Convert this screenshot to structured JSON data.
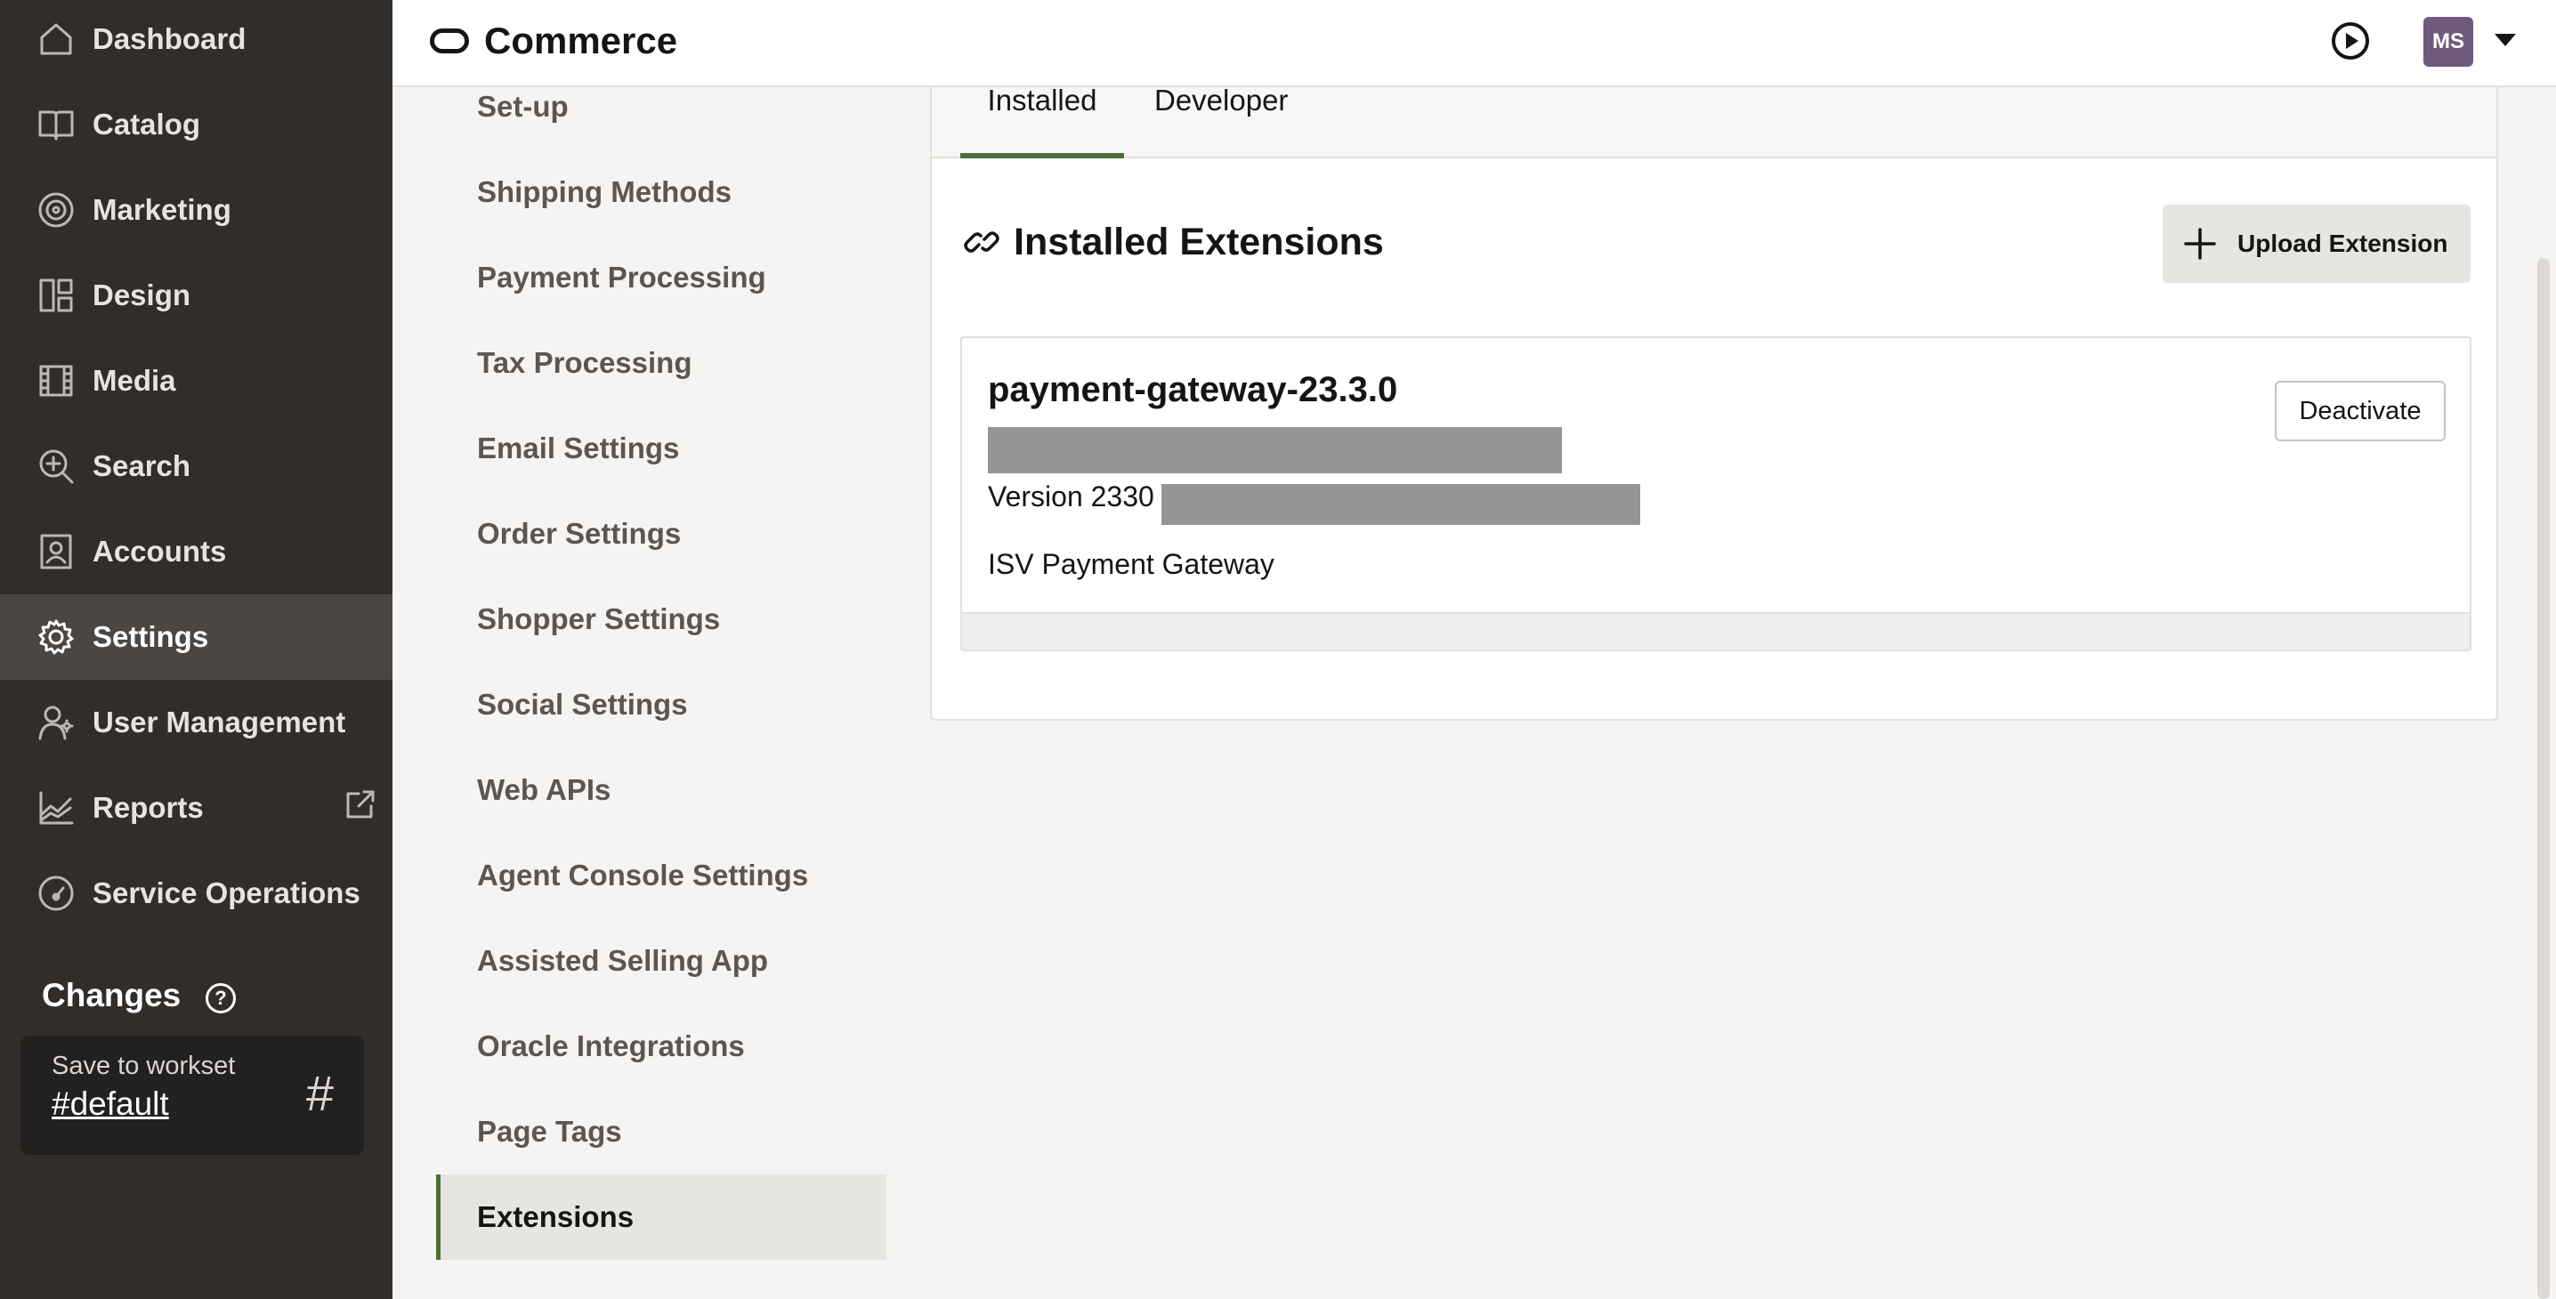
{
  "nav": {
    "items": [
      {
        "label": "Dashboard",
        "icon": "home-icon"
      },
      {
        "label": "Catalog",
        "icon": "book-icon"
      },
      {
        "label": "Marketing",
        "icon": "target-icon"
      },
      {
        "label": "Design",
        "icon": "layout-icon"
      },
      {
        "label": "Media",
        "icon": "film-icon"
      },
      {
        "label": "Search",
        "icon": "search-plus-icon"
      },
      {
        "label": "Accounts",
        "icon": "contact-card-icon"
      },
      {
        "label": "Settings",
        "icon": "gear-icon",
        "active": true
      },
      {
        "label": "User Management",
        "icon": "users-icon"
      },
      {
        "label": "Reports",
        "icon": "chart-icon",
        "external": true
      },
      {
        "label": "Service Operations",
        "icon": "gauge-icon"
      }
    ],
    "changes": {
      "title": "Changes",
      "help": "?",
      "workset_label": "Save to workset",
      "workset_value": "#default",
      "hash": "#"
    }
  },
  "header": {
    "title": "Commerce",
    "avatar_initials": "MS"
  },
  "settings_menu": {
    "items": [
      "Set-up",
      "Shipping Methods",
      "Payment Processing",
      "Tax Processing",
      "Email Settings",
      "Order Settings",
      "Shopper Settings",
      "Social Settings",
      "Web APIs",
      "Agent Console Settings",
      "Assisted Selling App",
      "Oracle Integrations",
      "Page Tags",
      "Extensions"
    ],
    "active": "Extensions"
  },
  "main": {
    "tabs": [
      {
        "label": "Installed",
        "active": true
      },
      {
        "label": "Developer",
        "active": false
      }
    ],
    "section_title": "Installed Extensions",
    "upload_button": "Upload Extension",
    "extension": {
      "name": "payment-gateway-23.3.0",
      "version": "Version 2330",
      "description": "ISV Payment Gateway",
      "deactivate_button": "Deactivate"
    }
  },
  "colors": {
    "nav_bg": "#312d2a",
    "accent": "#4d6e3a",
    "avatar": "#6f5a7e"
  }
}
